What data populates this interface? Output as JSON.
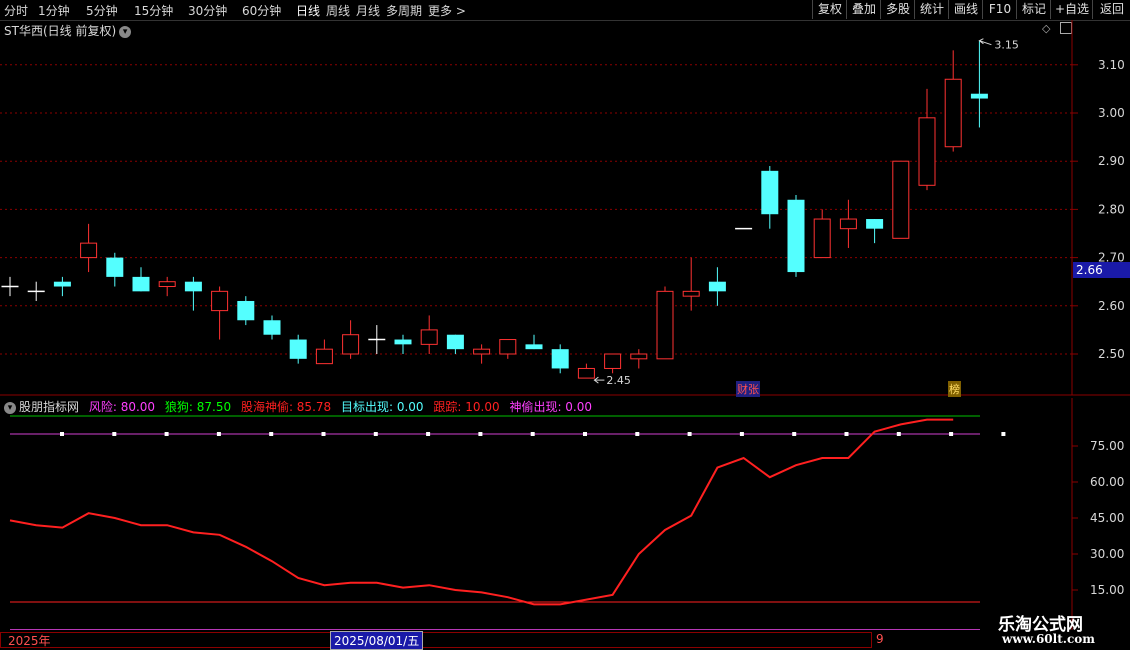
{
  "toolbar": {
    "periods": [
      "分时",
      "1分钟",
      "5分钟",
      "15分钟",
      "30分钟",
      "60分钟",
      "日线",
      "周线",
      "月线",
      "多周期",
      "更多 >"
    ],
    "active_period": "日线",
    "right_buttons": [
      "复权",
      "叠加",
      "多股",
      "统计",
      "画线",
      "F10",
      "标记",
      "+自选",
      "返回"
    ]
  },
  "main_chart": {
    "title": "ST华西(日线 前复权)",
    "price_ticks": [
      "3.10",
      "3.00",
      "2.90",
      "2.80",
      "2.70",
      "2.60",
      "2.50"
    ],
    "current_price_label": "2.66",
    "high_label": "3.15",
    "low_label": "2.45",
    "markers": [
      "财张",
      "榜"
    ],
    "colors": {
      "up": "#ff3232",
      "down": "#54ffff",
      "grid": "#8b0000",
      "bg": "#000000"
    },
    "candles": [
      {
        "o": 2.64,
        "h": 2.66,
        "l": 2.62,
        "c": 2.64
      },
      {
        "o": 2.63,
        "h": 2.65,
        "l": 2.61,
        "c": 2.63
      },
      {
        "o": 2.65,
        "h": 2.66,
        "l": 2.62,
        "c": 2.64
      },
      {
        "o": 2.7,
        "h": 2.77,
        "l": 2.67,
        "c": 2.73
      },
      {
        "o": 2.7,
        "h": 2.71,
        "l": 2.64,
        "c": 2.66
      },
      {
        "o": 2.66,
        "h": 2.68,
        "l": 2.63,
        "c": 2.63
      },
      {
        "o": 2.64,
        "h": 2.66,
        "l": 2.62,
        "c": 2.65
      },
      {
        "o": 2.65,
        "h": 2.66,
        "l": 2.59,
        "c": 2.63
      },
      {
        "o": 2.59,
        "h": 2.64,
        "l": 2.53,
        "c": 2.63
      },
      {
        "o": 2.61,
        "h": 2.62,
        "l": 2.56,
        "c": 2.57
      },
      {
        "o": 2.57,
        "h": 2.58,
        "l": 2.53,
        "c": 2.54
      },
      {
        "o": 2.53,
        "h": 2.54,
        "l": 2.48,
        "c": 2.49
      },
      {
        "o": 2.48,
        "h": 2.53,
        "l": 2.48,
        "c": 2.51
      },
      {
        "o": 2.5,
        "h": 2.57,
        "l": 2.49,
        "c": 2.54
      },
      {
        "o": 2.53,
        "h": 2.56,
        "l": 2.5,
        "c": 2.53
      },
      {
        "o": 2.53,
        "h": 2.54,
        "l": 2.5,
        "c": 2.52
      },
      {
        "o": 2.52,
        "h": 2.58,
        "l": 2.5,
        "c": 2.55
      },
      {
        "o": 2.54,
        "h": 2.54,
        "l": 2.5,
        "c": 2.51
      },
      {
        "o": 2.5,
        "h": 2.52,
        "l": 2.48,
        "c": 2.51
      },
      {
        "o": 2.5,
        "h": 2.53,
        "l": 2.49,
        "c": 2.53
      },
      {
        "o": 2.52,
        "h": 2.54,
        "l": 2.51,
        "c": 2.51
      },
      {
        "o": 2.51,
        "h": 2.52,
        "l": 2.46,
        "c": 2.47
      },
      {
        "o": 2.45,
        "h": 2.48,
        "l": 2.45,
        "c": 2.47
      },
      {
        "o": 2.47,
        "h": 2.5,
        "l": 2.46,
        "c": 2.5
      },
      {
        "o": 2.49,
        "h": 2.51,
        "l": 2.47,
        "c": 2.5
      },
      {
        "o": 2.49,
        "h": 2.64,
        "l": 2.49,
        "c": 2.63
      },
      {
        "o": 2.62,
        "h": 2.7,
        "l": 2.59,
        "c": 2.63
      },
      {
        "o": 2.65,
        "h": 2.68,
        "l": 2.6,
        "c": 2.63
      },
      {
        "o": 2.76,
        "h": 2.76,
        "l": 2.76,
        "c": 2.76
      },
      {
        "o": 2.88,
        "h": 2.89,
        "l": 2.76,
        "c": 2.79
      },
      {
        "o": 2.82,
        "h": 2.83,
        "l": 2.66,
        "c": 2.67
      },
      {
        "o": 2.7,
        "h": 2.8,
        "l": 2.7,
        "c": 2.78
      },
      {
        "o": 2.76,
        "h": 2.82,
        "l": 2.72,
        "c": 2.78
      },
      {
        "o": 2.78,
        "h": 2.78,
        "l": 2.73,
        "c": 2.76
      },
      {
        "o": 2.74,
        "h": 2.9,
        "l": 2.74,
        "c": 2.9
      },
      {
        "o": 2.85,
        "h": 3.05,
        "l": 2.84,
        "c": 2.99
      },
      {
        "o": 2.93,
        "h": 3.13,
        "l": 2.92,
        "c": 3.07
      },
      {
        "o": 3.04,
        "h": 3.15,
        "l": 2.97,
        "c": 3.03
      }
    ]
  },
  "indicator": {
    "name": "股朋指标网",
    "items": [
      {
        "label": "风险: 80.00",
        "color": "#ff40ff"
      },
      {
        "label": "狼狗: 87.50",
        "color": "#00ff00"
      },
      {
        "label": "股海神偷: 85.78",
        "color": "#ff2020"
      },
      {
        "label": "目标出现: 0.00",
        "color": "#54ffff"
      },
      {
        "label": "跟踪: 10.00",
        "color": "#ff2020"
      },
      {
        "label": "神偷出现: 0.00",
        "color": "#ff40ff"
      }
    ],
    "ticks": [
      "75.00",
      "60.00",
      "45.00",
      "30.00",
      "15.00"
    ],
    "line_values": [
      44,
      42,
      41,
      47,
      45,
      42,
      42,
      39,
      38,
      33,
      27,
      20,
      17,
      18,
      18,
      16,
      17,
      15,
      14,
      12,
      9,
      9,
      11,
      13,
      30,
      40,
      46,
      66,
      70,
      62,
      67,
      70,
      70,
      81,
      84,
      86,
      86
    ],
    "line_danger": 87.5,
    "line_risk": 80,
    "line_track": 10
  },
  "bottom": {
    "year": "2025年",
    "date": "2025/08/01/五",
    "marker": "9"
  },
  "watermark": {
    "title": "乐淘公式网",
    "url": "www.60lt.com"
  }
}
